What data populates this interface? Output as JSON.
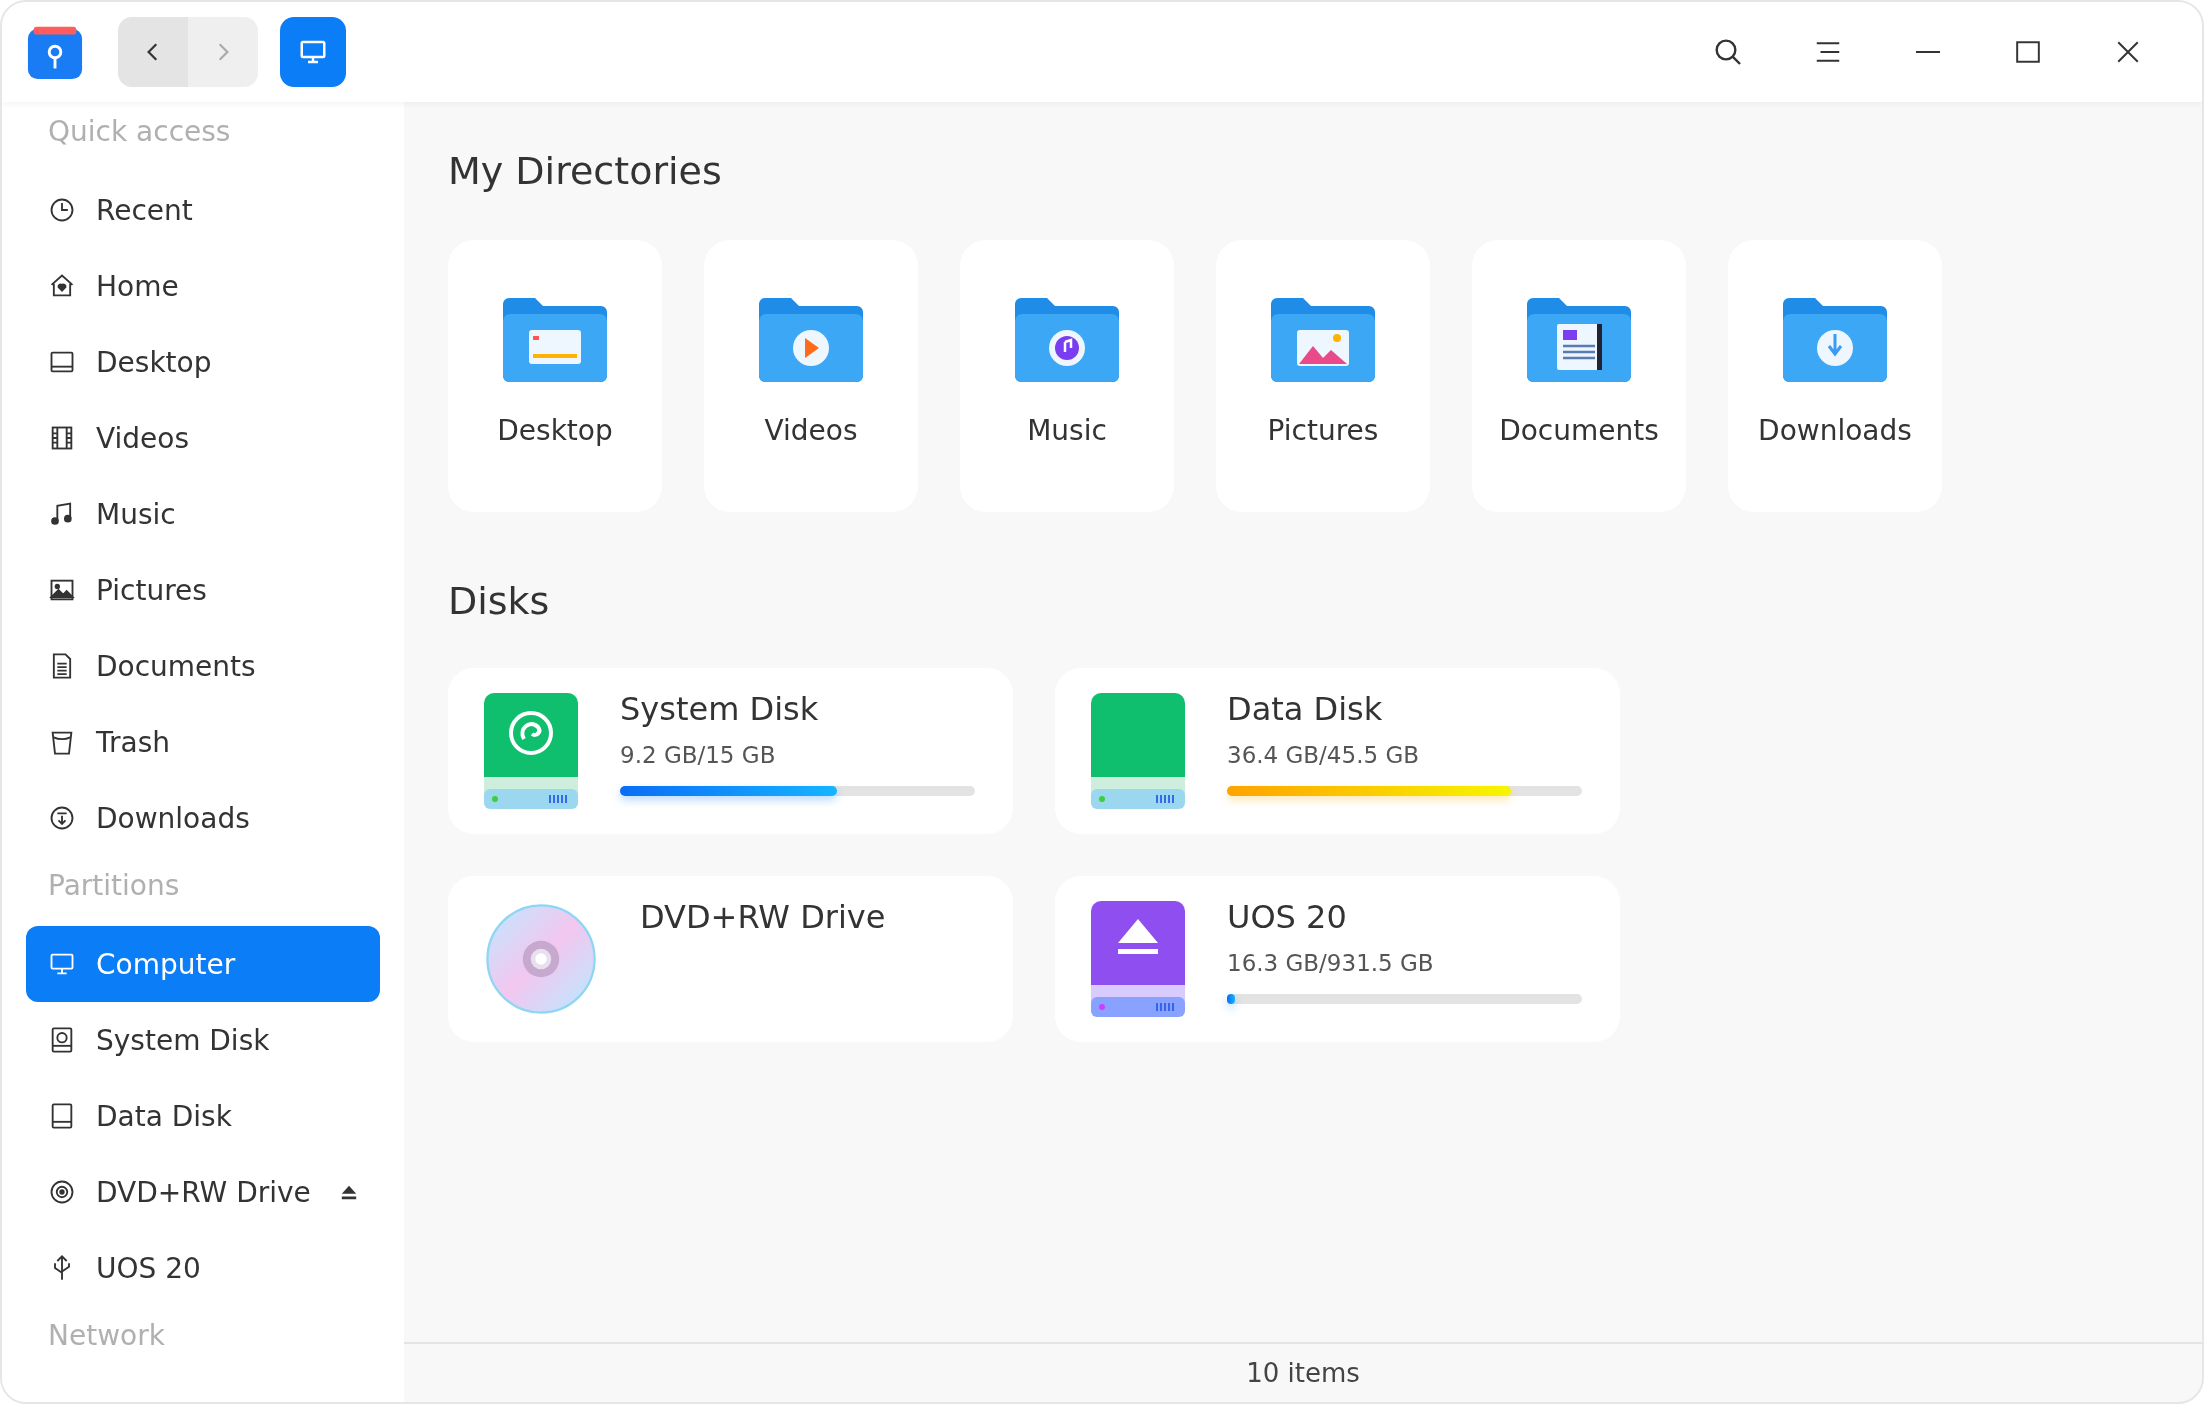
{
  "toolbar": {
    "back": {
      "disabled": false
    },
    "forward": {
      "disabled": true
    },
    "view_selected": true
  },
  "sidebar": {
    "sections": [
      {
        "title": "Quick access",
        "items": [
          {
            "label": "Recent",
            "kind": "recent",
            "selected": false,
            "ejectable": false
          },
          {
            "label": "Home",
            "kind": "home",
            "selected": false,
            "ejectable": false
          },
          {
            "label": "Desktop",
            "kind": "desktop",
            "selected": false,
            "ejectable": false
          },
          {
            "label": "Videos",
            "kind": "videos",
            "selected": false,
            "ejectable": false
          },
          {
            "label": "Music",
            "kind": "music",
            "selected": false,
            "ejectable": false
          },
          {
            "label": "Pictures",
            "kind": "pictures",
            "selected": false,
            "ejectable": false
          },
          {
            "label": "Documents",
            "kind": "documents",
            "selected": false,
            "ejectable": false
          },
          {
            "label": "Trash",
            "kind": "trash",
            "selected": false,
            "ejectable": false
          },
          {
            "label": "Downloads",
            "kind": "downloads",
            "selected": false,
            "ejectable": false
          }
        ]
      },
      {
        "title": "Partitions",
        "items": [
          {
            "label": "Computer",
            "kind": "computer",
            "selected": true,
            "ejectable": false
          },
          {
            "label": "System Disk",
            "kind": "sysdisk",
            "selected": false,
            "ejectable": false
          },
          {
            "label": "Data Disk",
            "kind": "disk",
            "selected": false,
            "ejectable": false
          },
          {
            "label": "DVD+RW Drive",
            "kind": "optical",
            "selected": false,
            "ejectable": true
          },
          {
            "label": "UOS 20",
            "kind": "usb",
            "selected": false,
            "ejectable": false
          }
        ]
      },
      {
        "title": "Network"
      }
    ]
  },
  "main": {
    "directories_title": "My Directories",
    "directories": [
      {
        "label": "Desktop",
        "kind": "desktop"
      },
      {
        "label": "Videos",
        "kind": "videos"
      },
      {
        "label": "Music",
        "kind": "music"
      },
      {
        "label": "Pictures",
        "kind": "pictures"
      },
      {
        "label": "Documents",
        "kind": "documents"
      },
      {
        "label": "Downloads",
        "kind": "downloads"
      }
    ],
    "disks_title": "Disks",
    "disks": [
      {
        "name": "System Disk",
        "kind": "system",
        "usage": "9.2 GB/15 GB",
        "level": 0.61
      },
      {
        "name": "Data Disk",
        "kind": "data",
        "usage": "36.4 GB/45.5 GB",
        "level": 0.8
      },
      {
        "name": "DVD+RW Drive",
        "kind": "optical"
      },
      {
        "name": "UOS 20",
        "kind": "usb",
        "usage": "16.3 GB/931.5 GB",
        "level": 0.02
      }
    ]
  },
  "status_bar": {
    "text": "10 items"
  }
}
